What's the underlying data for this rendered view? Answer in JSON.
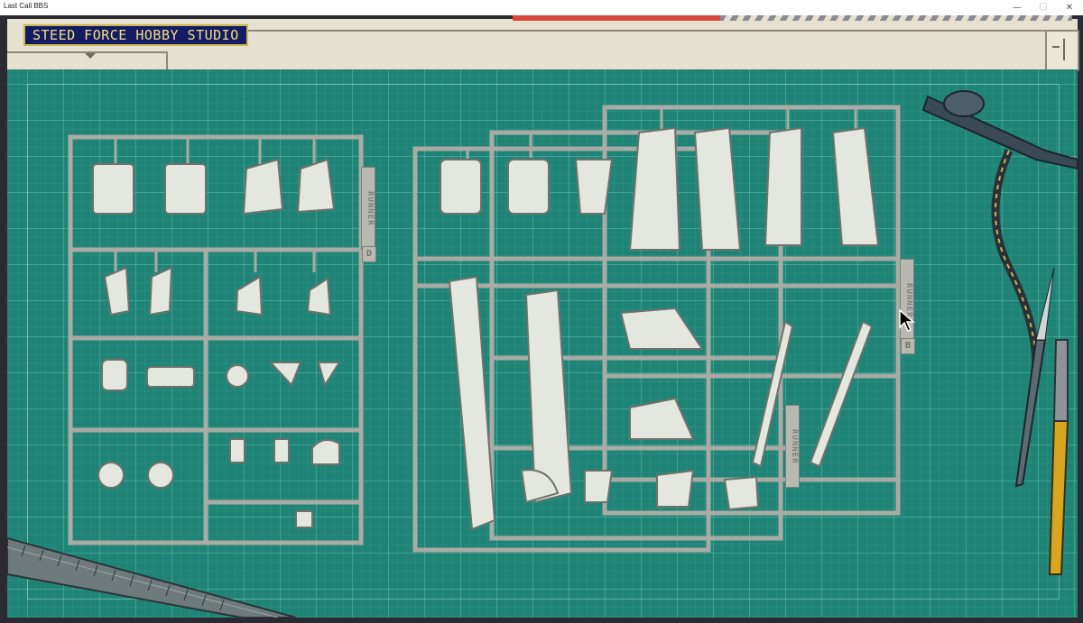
{
  "window": {
    "title": "Last Call BBS",
    "min_label": "—",
    "max_label": "☐",
    "close_label": "✕"
  },
  "header": {
    "studio_label": "STEED FORCE HOBBY STUDIO"
  },
  "runners": [
    {
      "tag": "RUNNER",
      "letter": "D"
    },
    {
      "tag": "RUNNER",
      "letter": "B"
    },
    {
      "tag": "RUNNER",
      "letter": ""
    }
  ],
  "colors": {
    "mat": "#1f8476",
    "sprue": "#a9aba4",
    "parts": "#e4e6e0",
    "label_bg": "#141a64",
    "label_text": "#f0e07a",
    "accent_red": "#d9463c"
  },
  "icons": {
    "cursor": "arrow-cursor-icon",
    "menu": "menu-toggle-icon"
  }
}
